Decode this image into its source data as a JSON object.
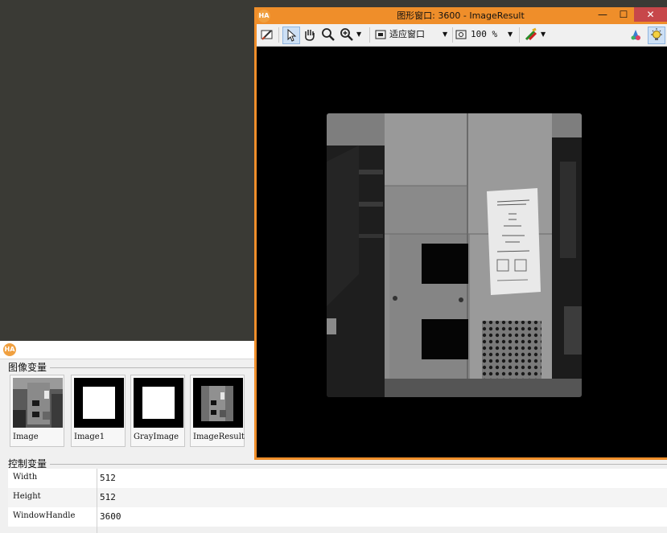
{
  "graphics_window": {
    "title": "图形窗口: 3600 - ImageResult",
    "logo": "HA",
    "minimize_label": "—",
    "maximize_label": "☐",
    "close_label": "✕",
    "toolbar": {
      "fit_label": "适应窗口",
      "zoom_value": "100 %"
    }
  },
  "variables_panel": {
    "logo": "HA",
    "image_section_title": "图像变量",
    "images": [
      {
        "name": "Image"
      },
      {
        "name": "Image1"
      },
      {
        "name": "GrayImage"
      },
      {
        "name": "ImageResult"
      }
    ],
    "control_section_title": "控制变量",
    "controls": [
      {
        "name": "Width",
        "value": "512"
      },
      {
        "name": "Height",
        "value": "512"
      },
      {
        "name": "WindowHandle",
        "value": "3600"
      }
    ]
  },
  "colors": {
    "window_frame": "#ef8e2a",
    "close_button": "#c7474a",
    "desktop": "#3a3a35",
    "panel_bg": "#f0f0f0"
  },
  "icons": [
    "settings-icon",
    "pointer-icon",
    "pan-hand-icon",
    "zoom-region-icon",
    "zoom-in-icon",
    "fit-window-icon",
    "zoom-percent-icon",
    "color-icon",
    "palette-icon",
    "bulb-icon"
  ]
}
